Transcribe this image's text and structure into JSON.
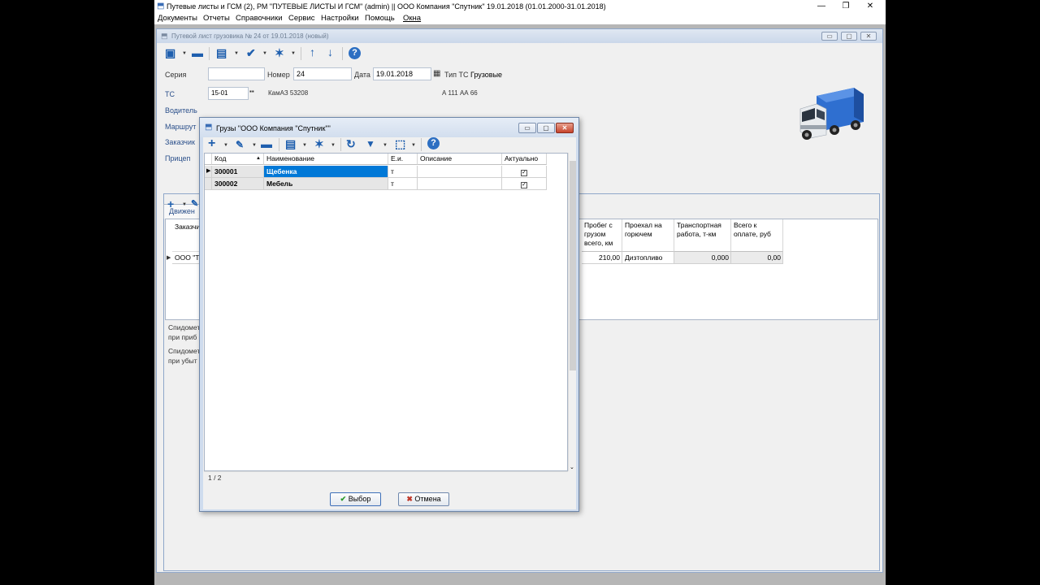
{
  "window": {
    "title": "Путевые листы и ГСМ (2), РМ \"ПУТЕВЫЕ ЛИСТЫ И ГСМ\" (admin) || ООО Компания \"Спутник\" 19.01.2018 (01.01.2000-31.01.2018)",
    "min": "—",
    "restore": "❐",
    "close": "✕"
  },
  "menu": [
    "Документы",
    "Отчеты",
    "Справочники",
    "Сервис",
    "Настройки",
    "Помощь",
    "Окна"
  ],
  "doc": {
    "title": "Путевой лист грузовика № 24 от 19.01.2018 (новый)",
    "fields": {
      "series_label": "Серия",
      "series_value": "",
      "number_label": "Номер",
      "number_value": "24",
      "date_label": "Дата",
      "date_value": "19.01.2018",
      "type_label": "Тип ТС",
      "type_value": "Грузовые"
    },
    "side_labels": {
      "ts": "ТС",
      "driver": "Водитель",
      "route": "Маршрут",
      "customer": "Заказчик",
      "trailer": "Прицеп"
    },
    "partial": {
      "ts_value": "15-01",
      "ts_model": "КамАЗ 53208",
      "plate": "А 111 АА 66",
      "tab": "Движен",
      "col_customer": "Заказчи",
      "row_customer": "ООО \"Те",
      "odo1_a": "Спидомет",
      "odo1_b": "при приб",
      "odo2_a": "Спидомет",
      "odo2_b": "при убыт"
    },
    "table": {
      "headers": [
        "Пробег с грузом всего, км",
        "Проехал на горючем",
        "Транспортная работа, т-км",
        "Всего к оплате, руб"
      ],
      "row": [
        "210,00",
        "Дизтопливо",
        "0,000",
        "0,00"
      ]
    }
  },
  "dialog": {
    "title": "Грузы  \"ООО Компания \"Спутник\"\"",
    "columns": [
      "Код",
      "Наименование",
      "Е.и.",
      "Описание",
      "Актуально"
    ],
    "rows": [
      {
        "code": "300001",
        "name": "Щебенка",
        "unit": "т",
        "desc": "",
        "active": "✓"
      },
      {
        "code": "300002",
        "name": "Мебель",
        "unit": "т",
        "desc": "",
        "active": "✓"
      }
    ],
    "status": "1 / 2",
    "ok_label": "Выбор",
    "cancel_label": "Отмена",
    "sort_indicator": "▲"
  },
  "icons": {
    "save": "save-icon",
    "print": "printer-icon",
    "check": "check-icon",
    "wand": "magic-wand-icon",
    "help": "help-icon",
    "add": "plus-icon",
    "edit": "pencil-icon",
    "remove": "minus-icon",
    "refresh": "refresh-icon",
    "filter": "filter-icon"
  },
  "colors": {
    "selection": "#0078d7",
    "accent": "#1f5fae"
  }
}
